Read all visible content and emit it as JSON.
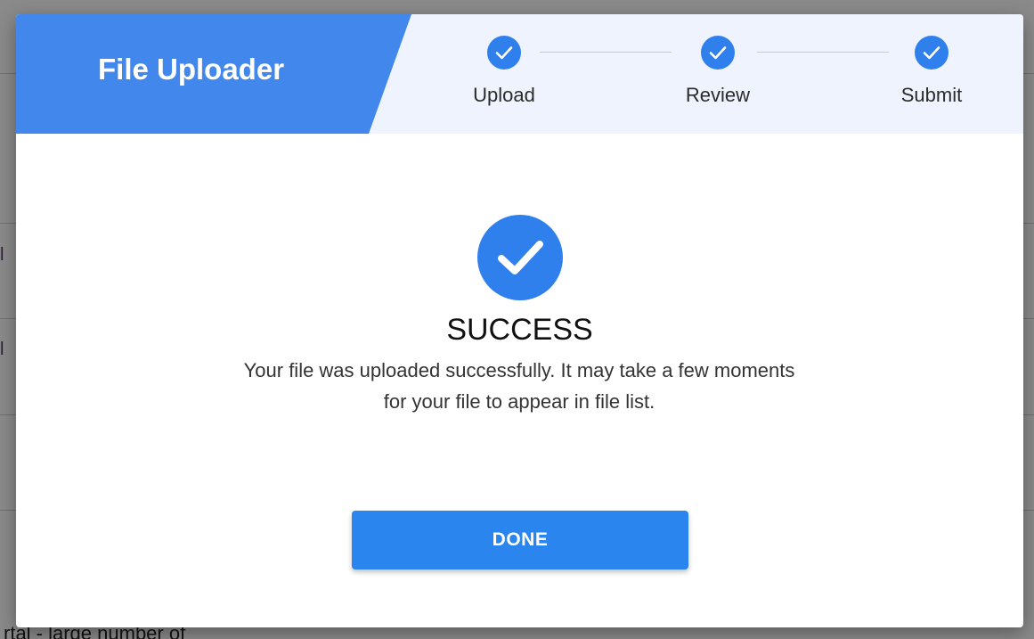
{
  "background": {
    "partial_text": "rtal - large number of",
    "fragments": [
      "l",
      "l"
    ]
  },
  "dialog": {
    "title": "File Uploader",
    "steps": [
      {
        "label": "Upload",
        "icon": "check-icon",
        "state": "complete"
      },
      {
        "label": "Review",
        "icon": "check-icon",
        "state": "complete"
      },
      {
        "label": "Submit",
        "icon": "check-icon",
        "state": "complete"
      }
    ],
    "success": {
      "icon": "check-circle-icon",
      "heading": "SUCCESS",
      "message": "Your file was uploaded successfully. It may take a few moments for your file to appear in file list."
    },
    "done_label": "DONE"
  },
  "colors": {
    "primary": "#2f80ed",
    "title_band": "#4287ec",
    "header_bg": "#eef3fd",
    "button": "#2a86ee",
    "overlay": "rgba(0,0,0,0.46)"
  }
}
